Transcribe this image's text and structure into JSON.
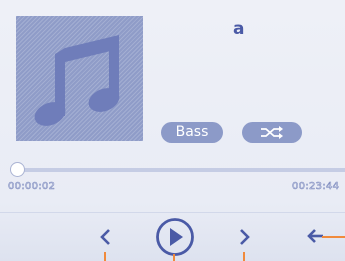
{
  "player": {
    "track_title": "a",
    "bass_label": "Bass",
    "elapsed_time": "00:00:02",
    "total_time": "00:23:44",
    "progress_fraction": 0.0014
  },
  "icons": {
    "album_art": "music-note-icon",
    "shuffle": "shuffle-icon",
    "previous": "chevron-left-icon",
    "play": "play-icon",
    "next": "chevron-right-icon",
    "back": "back-arrow-icon"
  },
  "colors": {
    "accent": "#4a5aa6",
    "pill": "#8c9ac8",
    "callout": "#f08a3c"
  }
}
